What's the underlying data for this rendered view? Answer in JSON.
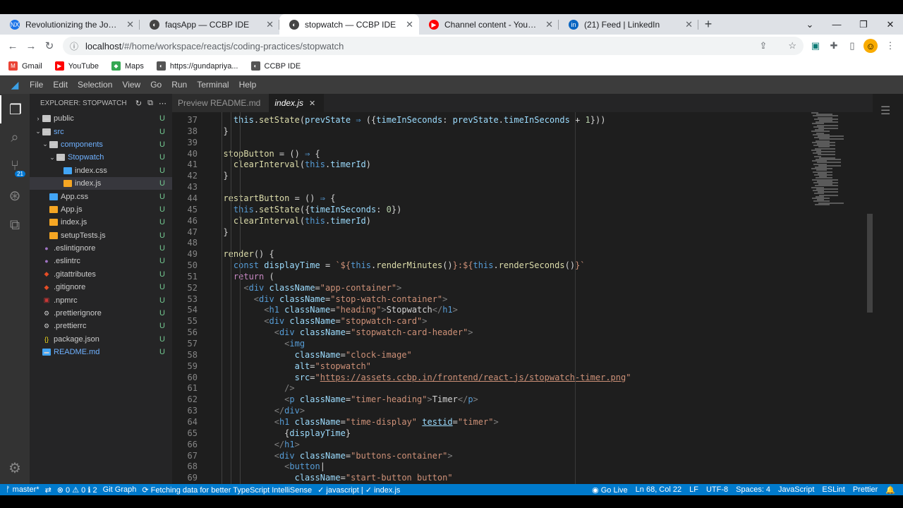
{
  "browser": {
    "tabs": [
      {
        "label": "Revolutionizing the Job Market | N",
        "favicon": "NX",
        "color": "#1a73e8",
        "active": false
      },
      {
        "label": "faqsApp — CCBP IDE",
        "favicon": "◐",
        "color": "#444",
        "active": false
      },
      {
        "label": "stopwatch — CCBP IDE",
        "favicon": "◐",
        "color": "#444",
        "active": true
      },
      {
        "label": "Channel content - YouTube Studio",
        "favicon": "▶",
        "color": "#ff0000",
        "active": false
      },
      {
        "label": "(21) Feed | LinkedIn",
        "favicon": "in",
        "color": "#0a66c2",
        "active": false
      }
    ],
    "address_host": "localhost",
    "address_path": "/#/home/workspace/reactjs/coding-practices/stopwatch",
    "bookmarks": [
      {
        "label": "Gmail",
        "icon": "gmail-icon",
        "color": "#ea4335",
        "glyph": "M"
      },
      {
        "label": "YouTube",
        "icon": "youtube-icon",
        "color": "#ff0000",
        "glyph": "▶"
      },
      {
        "label": "Maps",
        "icon": "maps-icon",
        "color": "#34a853",
        "glyph": "◆"
      },
      {
        "label": "https://gundapriya...",
        "icon": "globe-icon",
        "color": "#555",
        "glyph": "◐"
      },
      {
        "label": "CCBP IDE",
        "icon": "globe-icon",
        "color": "#555",
        "glyph": "◐"
      }
    ]
  },
  "menu": [
    "File",
    "Edit",
    "Selection",
    "View",
    "Go",
    "Run",
    "Terminal",
    "Help"
  ],
  "explorer": {
    "title": "EXPLORER: STOPWATCH",
    "items": [
      {
        "label": "public",
        "indent": 0,
        "type": "folder",
        "chev": "›",
        "status": "U"
      },
      {
        "label": "src",
        "indent": 0,
        "type": "folder-open",
        "chev": "⌄",
        "status": "U"
      },
      {
        "label": "components",
        "indent": 1,
        "type": "folder-open",
        "chev": "⌄",
        "status": "U"
      },
      {
        "label": "Stopwatch",
        "indent": 2,
        "type": "folder-open",
        "chev": "⌄",
        "status": "U"
      },
      {
        "label": "index.css",
        "indent": 3,
        "type": "css",
        "chev": "",
        "status": "U"
      },
      {
        "label": "index.js",
        "indent": 3,
        "type": "js",
        "chev": "",
        "status": "U",
        "selected": true
      },
      {
        "label": "App.css",
        "indent": 1,
        "type": "css",
        "chev": "",
        "status": "U"
      },
      {
        "label": "App.js",
        "indent": 1,
        "type": "js",
        "chev": "",
        "status": "U"
      },
      {
        "label": "index.js",
        "indent": 1,
        "type": "js",
        "chev": "",
        "status": "U"
      },
      {
        "label": "setupTests.js",
        "indent": 1,
        "type": "js",
        "chev": "",
        "status": "U"
      },
      {
        "label": ".eslintignore",
        "indent": 0,
        "type": "dot",
        "chev": "",
        "status": "U"
      },
      {
        "label": ".eslintrc",
        "indent": 0,
        "type": "dot",
        "chev": "",
        "status": "U"
      },
      {
        "label": ".gitattributes",
        "indent": 0,
        "type": "git",
        "chev": "",
        "status": "U"
      },
      {
        "label": ".gitignore",
        "indent": 0,
        "type": "git",
        "chev": "",
        "status": "U"
      },
      {
        "label": ".npmrc",
        "indent": 0,
        "type": "npm",
        "chev": "",
        "status": "U"
      },
      {
        "label": ".prettierignore",
        "indent": 0,
        "type": "gear",
        "chev": "",
        "status": "U"
      },
      {
        "label": ".prettierrc",
        "indent": 0,
        "type": "gear",
        "chev": "",
        "status": "U"
      },
      {
        "label": "package.json",
        "indent": 0,
        "type": "json",
        "chev": "",
        "status": "U"
      },
      {
        "label": "README.md",
        "indent": 0,
        "type": "md",
        "chev": "",
        "status": "U"
      }
    ]
  },
  "editor": {
    "tabs": [
      {
        "label": "Preview README.md",
        "active": false
      },
      {
        "label": "index.js",
        "active": true
      }
    ],
    "lines": [
      {
        "n": "37",
        "html": "  <span class='c-var'>this</span>.<span class='c-fn'>setState</span>(<span class='c-var'>prevState</span> <span class='c-kw'>⇒</span> ({<span class='c-var'>timeInSeconds</span>: <span class='c-var'>prevState</span>.<span class='c-var'>timeInSeconds</span> + <span class='c-num'>1</span>}))"
      },
      {
        "n": "38",
        "html": "}"
      },
      {
        "n": "39",
        "html": ""
      },
      {
        "n": "40",
        "html": "<span class='c-fn'>stopButton</span> = () <span class='c-kw'>⇒</span> {"
      },
      {
        "n": "41",
        "html": "  <span class='c-fn'>clearInterval</span>(<span class='c-kw'>this</span>.<span class='c-var'>timerId</span>)"
      },
      {
        "n": "42",
        "html": "}"
      },
      {
        "n": "43",
        "html": ""
      },
      {
        "n": "44",
        "html": "<span class='c-fn'>restartButton</span> = () <span class='c-kw'>⇒</span> {"
      },
      {
        "n": "45",
        "html": "  <span class='c-kw'>this</span>.<span class='c-fn'>setState</span>({<span class='c-var'>timeInSeconds</span>: <span class='c-num'>0</span>})"
      },
      {
        "n": "46",
        "html": "  <span class='c-fn'>clearInterval</span>(<span class='c-kw'>this</span>.<span class='c-var'>timerId</span>)"
      },
      {
        "n": "47",
        "html": "}"
      },
      {
        "n": "48",
        "html": ""
      },
      {
        "n": "49",
        "html": "<span class='c-fn'>render</span>() {"
      },
      {
        "n": "50",
        "html": "  <span class='c-kw'>const</span> <span class='c-var'>displayTime</span> = <span class='c-str'>`${</span><span class='c-kw'>this</span>.<span class='c-fn'>renderMinutes</span>()<span class='c-str'>}:${</span><span class='c-kw'>this</span>.<span class='c-fn'>renderSeconds</span>()<span class='c-str'>}`</span>"
      },
      {
        "n": "51",
        "html": "  <span class='c-ctl'>return</span> ("
      },
      {
        "n": "52",
        "html": "    <span class='c-punc'>&lt;</span><span class='c-tag'>div</span> <span class='c-attr'>className</span>=<span class='c-str'>\"app-container\"</span><span class='c-punc'>&gt;</span>"
      },
      {
        "n": "53",
        "html": "      <span class='c-punc'>&lt;</span><span class='c-tag'>div</span> <span class='c-attr'>className</span>=<span class='c-str'>\"stop-watch-container\"</span><span class='c-punc'>&gt;</span>"
      },
      {
        "n": "54",
        "html": "        <span class='c-punc'>&lt;</span><span class='c-tag'>h1</span> <span class='c-attr'>className</span>=<span class='c-str'>\"heading\"</span><span class='c-punc'>&gt;</span>Stopwatch<span class='c-punc'>&lt;/</span><span class='c-tag'>h1</span><span class='c-punc'>&gt;</span>"
      },
      {
        "n": "55",
        "html": "        <span class='c-punc'>&lt;</span><span class='c-tag'>div</span> <span class='c-attr'>className</span>=<span class='c-str'>\"stopwatch-card\"</span><span class='c-punc'>&gt;</span>"
      },
      {
        "n": "56",
        "html": "          <span class='c-punc'>&lt;</span><span class='c-tag'>div</span> <span class='c-attr'>className</span>=<span class='c-str'>\"stopwatch-card-header\"</span><span class='c-punc'>&gt;</span>"
      },
      {
        "n": "57",
        "html": "            <span class='c-punc'>&lt;</span><span class='c-tag'>img</span>"
      },
      {
        "n": "58",
        "html": "              <span class='c-attr'>className</span>=<span class='c-str'>\"clock-image\"</span>"
      },
      {
        "n": "59",
        "html": "              <span class='c-attr'>alt</span>=<span class='c-str'>\"stopwatch\"</span>"
      },
      {
        "n": "60",
        "html": "              <span class='c-attr'>src</span>=<span class='c-str'>\"</span><span class='c-url'>https://assets.ccbp.in/frontend/react-js/stopwatch-timer.png</span><span class='c-str'>\"</span>"
      },
      {
        "n": "61",
        "html": "            <span class='c-punc'>/&gt;</span>"
      },
      {
        "n": "62",
        "html": "            <span class='c-punc'>&lt;</span><span class='c-tag'>p</span> <span class='c-attr'>className</span>=<span class='c-str'>\"timer-heading\"</span><span class='c-punc'>&gt;</span>Timer<span class='c-punc'>&lt;/</span><span class='c-tag'>p</span><span class='c-punc'>&gt;</span>"
      },
      {
        "n": "63",
        "html": "          <span class='c-punc'>&lt;/</span><span class='c-tag'>div</span><span class='c-punc'>&gt;</span>"
      },
      {
        "n": "64",
        "html": "          <span class='c-punc'>&lt;</span><span class='c-tag'>h1</span> <span class='c-attr'>className</span>=<span class='c-str'>\"time-display\"</span> <span class='c-attr' style='text-decoration:underline'>testid</span>=<span class='c-str'>\"timer\"</span><span class='c-punc'>&gt;</span>"
      },
      {
        "n": "65",
        "html": "            {<span class='c-var'>displayTime</span>}"
      },
      {
        "n": "66",
        "html": "          <span class='c-punc'>&lt;/</span><span class='c-tag'>h1</span><span class='c-punc'>&gt;</span>"
      },
      {
        "n": "67",
        "html": "          <span class='c-punc'>&lt;</span><span class='c-tag'>div</span> <span class='c-attr'>className</span>=<span class='c-str'>\"buttons-container\"</span><span class='c-punc'>&gt;</span>"
      },
      {
        "n": "68",
        "html": "            <span class='c-punc'>&lt;</span><span class='c-tag'>button</span>|"
      },
      {
        "n": "69",
        "html": "              <span class='c-attr'>className</span>=<span class='c-str'>\"start-button button\"</span>"
      }
    ]
  },
  "status": {
    "branch": "ᚠ master*",
    "sync": "⇄",
    "problems": "⊗ 0 ⚠ 0 ℹ 2",
    "git_graph": "Git Graph",
    "fetching": "⟳ Fetching data for better TypeScript IntelliSense",
    "lang_check": "✓ javascript | ✓ index.js",
    "go_live": "◉ Go Live",
    "position": "Ln 68, Col 22",
    "eol": "LF",
    "encoding": "UTF-8",
    "spaces": "Spaces: 4",
    "language": "JavaScript",
    "eslint": "ESLint",
    "prettier": "Prettier",
    "bell": "🔔"
  }
}
